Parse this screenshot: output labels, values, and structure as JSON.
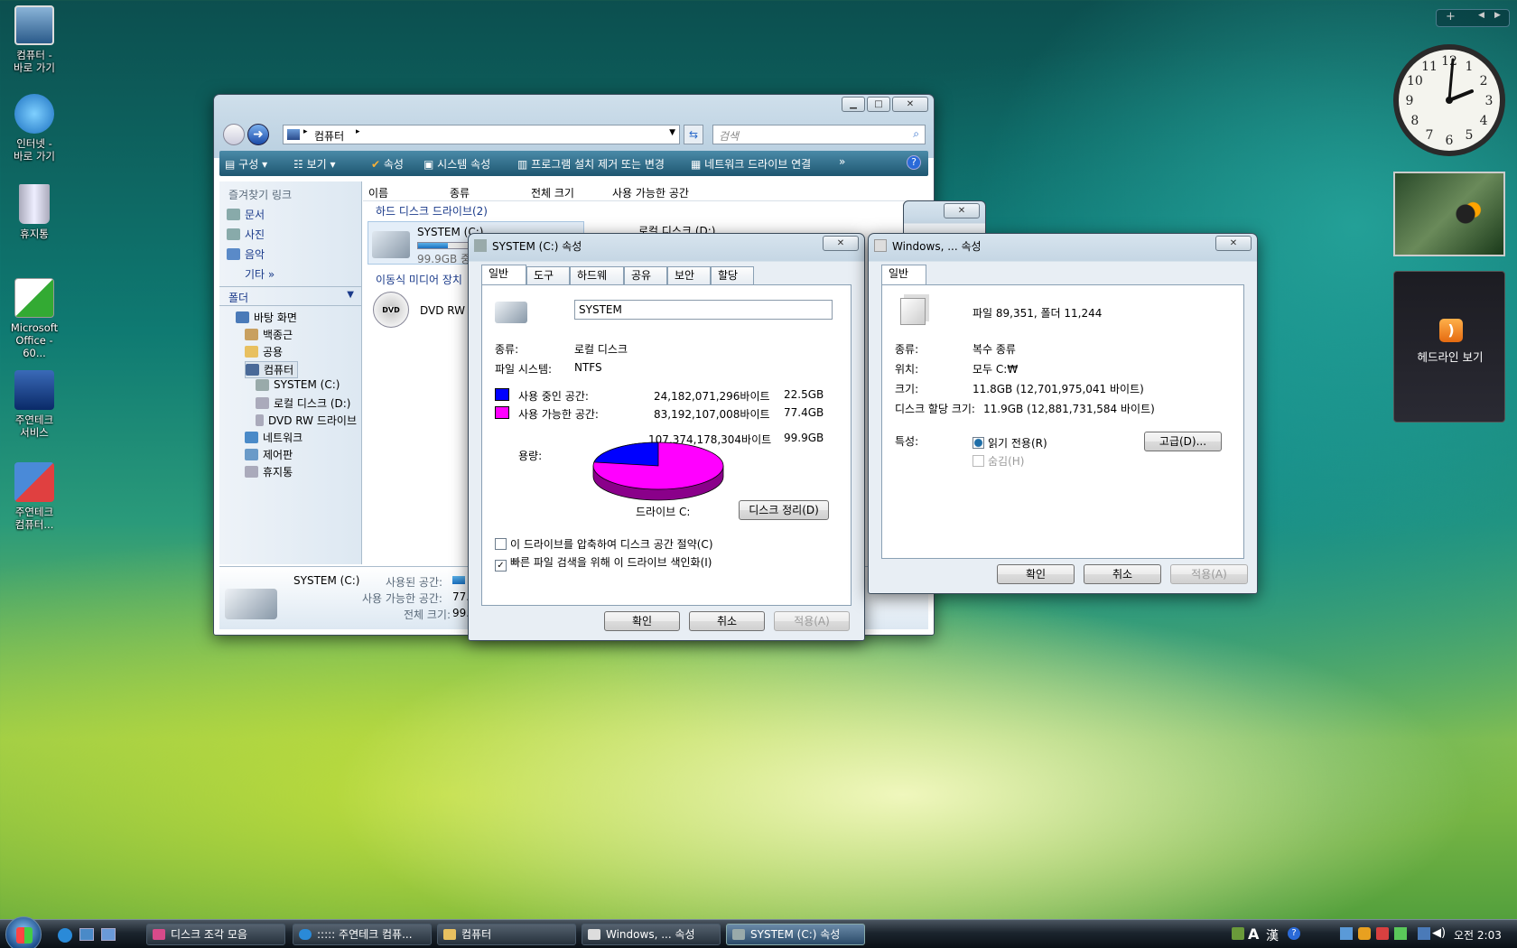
{
  "desktop": {
    "icons": [
      {
        "label": "컴퓨터 -\n바로 가기"
      },
      {
        "label": "인터넷 -\n바로 가기"
      },
      {
        "label": "휴지통"
      },
      {
        "label": "Microsoft\nOffice - 60..."
      },
      {
        "label": "주연테크\n서비스"
      },
      {
        "label": "주연테크\n컴퓨터..."
      }
    ]
  },
  "sidebar_gadgets": {
    "clock": {
      "numbers": [
        "12",
        "1",
        "2",
        "3",
        "4",
        "5",
        "6",
        "7",
        "8",
        "9",
        "10",
        "11"
      ]
    },
    "headlines": {
      "label": "헤드라인 보기"
    }
  },
  "explorer": {
    "address": {
      "segments": [
        "컴퓨터"
      ]
    },
    "search": {
      "placeholder": "검색"
    },
    "toolbar": [
      "구성",
      "보기",
      "속성",
      "시스템 속성",
      "프로그램 설치 제거 또는 변경",
      "네트워크 드라이브 연결",
      "»"
    ],
    "nav": {
      "favorites_header": "즐겨찾기 링크",
      "favorites": [
        "문서",
        "사진",
        "음악",
        "기타 »"
      ],
      "folders_header": "폴더",
      "tree": [
        "바탕 화면",
        "백종근",
        "공용",
        "컴퓨터",
        "SYSTEM (C:)",
        "로컬 디스크 (D:)",
        "DVD RW 드라이브",
        "네트워크",
        "제어판",
        "휴지통"
      ]
    },
    "columns": [
      "이름",
      "종류",
      "전체 크기",
      "사용 가능한 공간"
    ],
    "groups": {
      "hdd": "하드 디스크 드라이브(2)",
      "removable": "이동식 미디어 장치"
    },
    "drives": {
      "c_name": "SYSTEM (C:)",
      "c_free": "99.9GB 중",
      "c_used_fraction": 0.225,
      "d_name": "로컬 디스크 (D:)",
      "dvd_name": "DVD RW"
    },
    "details": {
      "name": "SYSTEM (C:)",
      "used_label": "사용된 공간:",
      "free_label": "사용 가능한 공간:",
      "free_value": "77.",
      "total_label": "전체 크기:",
      "total_value": "99."
    }
  },
  "sysprops": {
    "title": "SYSTEM (C:) 속성",
    "tabs": [
      "일반",
      "도구",
      "하드웨어",
      "공유",
      "보안",
      "할당량"
    ],
    "name_value": "SYSTEM",
    "type_label": "종류:",
    "type_value": "로컬 디스크",
    "fs_label": "파일 시스템:",
    "fs_value": "NTFS",
    "used_label": "사용 중인 공간:",
    "used_bytes": "24,182,071,296바이트",
    "used_gb": "22.5GB",
    "free_label": "사용 가능한 공간:",
    "free_bytes": "83,192,107,008바이트",
    "free_gb": "77.4GB",
    "capacity_label": "용량:",
    "capacity_bytes": "107,374,178,304바이트",
    "capacity_gb": "99.9GB",
    "drive_label": "드라이브 C:",
    "cleanup_button": "디스크 정리(D)",
    "compress_check": "이 드라이브를 압축하여 디스크 공간 절약(C)",
    "index_check": "빠른 파일 검색을 위해 이 드라이브 색인화(I)",
    "compress_checked": false,
    "index_checked": true,
    "ok": "확인",
    "cancel": "취소",
    "apply": "적용(A)",
    "pie": {
      "used_fraction": 0.225,
      "used_color": "#0000ff",
      "free_color": "#ff00ff"
    }
  },
  "winprops": {
    "title": "Windows, ... 속성",
    "tabs": [
      "일반"
    ],
    "files_summary": "파일 89,351, 폴더 11,244",
    "type_label": "종류:",
    "type_value": "복수 종류",
    "location_label": "위치:",
    "location_value": "모두 C:₩",
    "size_label": "크기:",
    "size_value": "11.8GB (12,701,975,041 바이트)",
    "disk_size_label": "디스크 할당 크기:",
    "disk_size_value": "11.9GB (12,881,731,584 바이트)",
    "attrs_label": "특성:",
    "readonly": "읽기 전용(R)",
    "hidden": "숨김(H)",
    "advanced": "고급(D)...",
    "ok": "확인",
    "cancel": "취소",
    "apply": "적용(A)"
  },
  "taskbar": {
    "buttons": [
      "디스크 조각 모음",
      "::::: 주연테크 컴퓨...",
      "컴퓨터",
      "Windows, ... 속성",
      "SYSTEM (C:) 속성"
    ],
    "ime": [
      "A",
      "漢"
    ],
    "clock": "오전 2:03"
  }
}
